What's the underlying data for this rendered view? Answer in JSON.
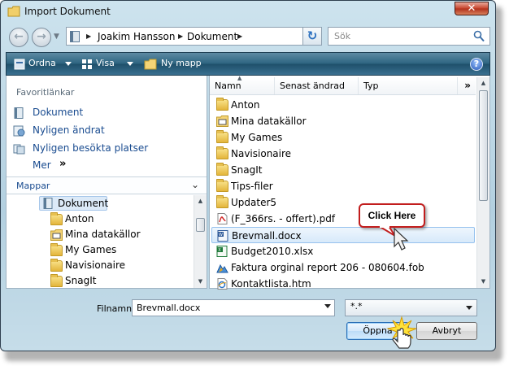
{
  "window": {
    "title": "Import Dokument",
    "close_glyph": "✕"
  },
  "address": {
    "segments": [
      "Joakim Hansson",
      "Dokument"
    ],
    "refresh_glyph": "↻"
  },
  "search": {
    "placeholder": "Sök"
  },
  "toolbar": {
    "ordna": "Ordna",
    "visa": "Visa",
    "ny_mapp": "Ny mapp",
    "help_glyph": "?"
  },
  "favorites": {
    "title": "Favoritlänkar",
    "items": [
      "Dokument",
      "Nyligen ändrat",
      "Nyligen besökta platser"
    ],
    "more": "Mer",
    "more_glyph": "»"
  },
  "folders": {
    "title": "Mappar",
    "chevron": "⌄",
    "items": [
      "Dokument",
      "Anton",
      "Mina datakällor",
      "My Games",
      "Navisionaire",
      "SnagIt"
    ]
  },
  "list": {
    "columns": [
      "Namn",
      "Senast ändrad",
      "Typ"
    ],
    "more_columns": "»",
    "files": [
      {
        "name": "Anton",
        "icon": "folder-icon"
      },
      {
        "name": "Mina datakällor",
        "icon": "data-sources-icon"
      },
      {
        "name": "My Games",
        "icon": "folder-icon"
      },
      {
        "name": "Navisionaire",
        "icon": "folder-icon"
      },
      {
        "name": "SnagIt",
        "icon": "folder-icon"
      },
      {
        "name": "Tips-filer",
        "icon": "folder-icon"
      },
      {
        "name": "Updater5",
        "icon": "folder-icon"
      },
      {
        "name": "(F_366rs. - offert).pdf",
        "icon": "pdf-icon"
      },
      {
        "name": "Brevmall.docx",
        "icon": "word-document-icon"
      },
      {
        "name": "Budget2010.xlsx",
        "icon": "excel-document-icon"
      },
      {
        "name": "Faktura orginal report 206 - 080604.fob",
        "icon": "fob-file-icon"
      },
      {
        "name": "Kontaktlista.htm",
        "icon": "html-file-icon"
      }
    ],
    "selected_index": 8
  },
  "bottom": {
    "filename_label": "Filnamn:",
    "filename_value": "Brevmall.docx",
    "filetype_value": "*.*",
    "open_button": "Öppna",
    "cancel_button": "Avbryt"
  },
  "callout": {
    "text": "Click Here"
  },
  "colors": {
    "toolbar": "#2e6581",
    "link_blue": "#1a4c90",
    "callout_border": "#c21d1d",
    "selection": "#d7e9fa"
  }
}
